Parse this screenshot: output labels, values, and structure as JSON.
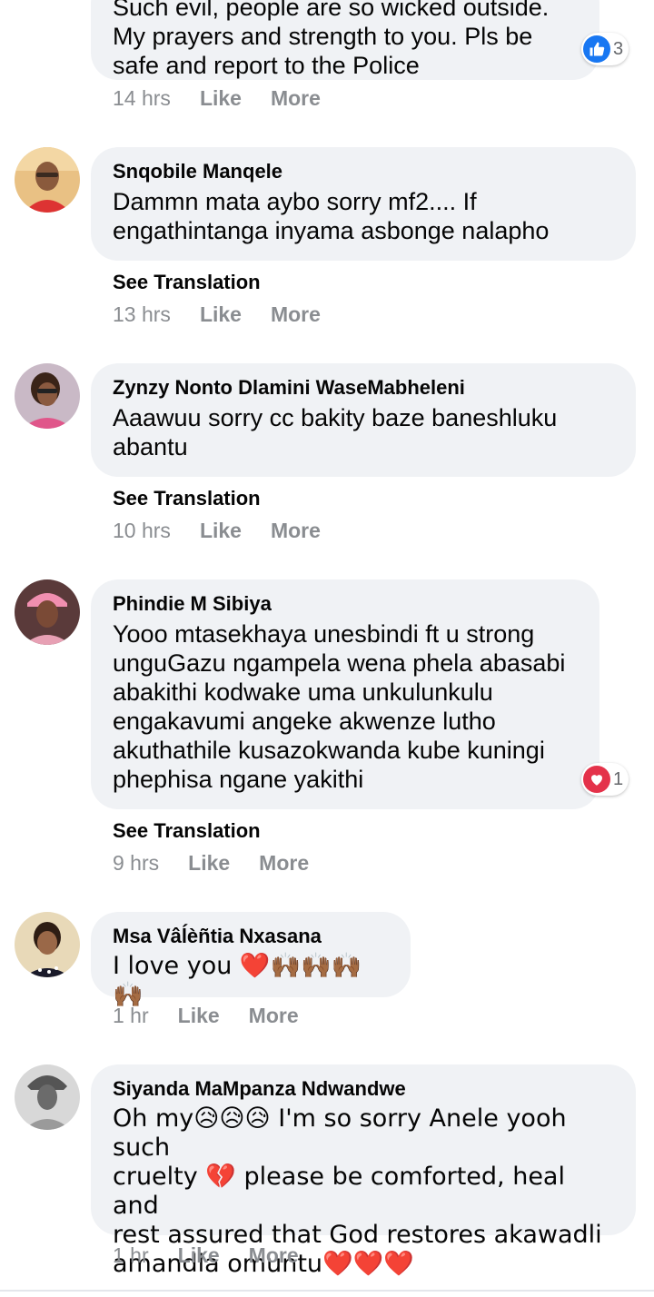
{
  "colors": {
    "bubble": "#f0f2f5",
    "meta": "#8a8d91",
    "like_blue": "#1877f2",
    "love_red": "#e4324a"
  },
  "comments": [
    {
      "text": "Such evil, people are so wicked outside.\nMy prayers and strength to you. Pls be\nsafe and report to the Police",
      "time": "14 hrs",
      "like": "Like",
      "more": "More",
      "reaction": {
        "icon": "like-icon",
        "count": "3"
      }
    },
    {
      "author": "Snqobile Manqele",
      "text": "Dammn mata aybo sorry mf2.... If\nengathintanga inyama asbonge nalapho",
      "see_translation": "See Translation",
      "time": "13 hrs",
      "like": "Like",
      "more": "More"
    },
    {
      "author": "Zynzy Nonto Dlamini WaseMabheleni",
      "text": "Aaawuu sorry cc bakity baze baneshluku\nabantu",
      "see_translation": "See Translation",
      "time": "10 hrs",
      "like": "Like",
      "more": "More"
    },
    {
      "author": "Phindie M Sibiya",
      "text": "Yooo mtasekhaya unesbindi ft u strong\nunguGazu ngampela wena phela abasabi\nabakithi kodwake uma unkulunkulu\nengakavumi angeke akwenze lutho\nakuthathile kusazokwanda kube kuningi\nphephisa ngane yakithi",
      "see_translation": "See Translation",
      "time": "9 hrs",
      "like": "Like",
      "more": "More",
      "reaction": {
        "icon": "love-icon",
        "count": "1"
      }
    },
    {
      "author": "Msa Vâĺèñtia Nxasana",
      "text": "I love you ❤️🙌🏾🙌🏾🙌🏾🙌🏾",
      "time": "1 hr",
      "like": "Like",
      "more": "More"
    },
    {
      "author": "Siyanda MaMpanza Ndwandwe",
      "text": "Oh my😥😥😥 I'm so sorry Anele yooh such\ncruelty 💔 please be comforted, heal and\nrest assured that God restores akawadli\namandla omuntu❤️❤️❤️",
      "time": "1 hr",
      "like": "Like",
      "more": "More"
    }
  ]
}
